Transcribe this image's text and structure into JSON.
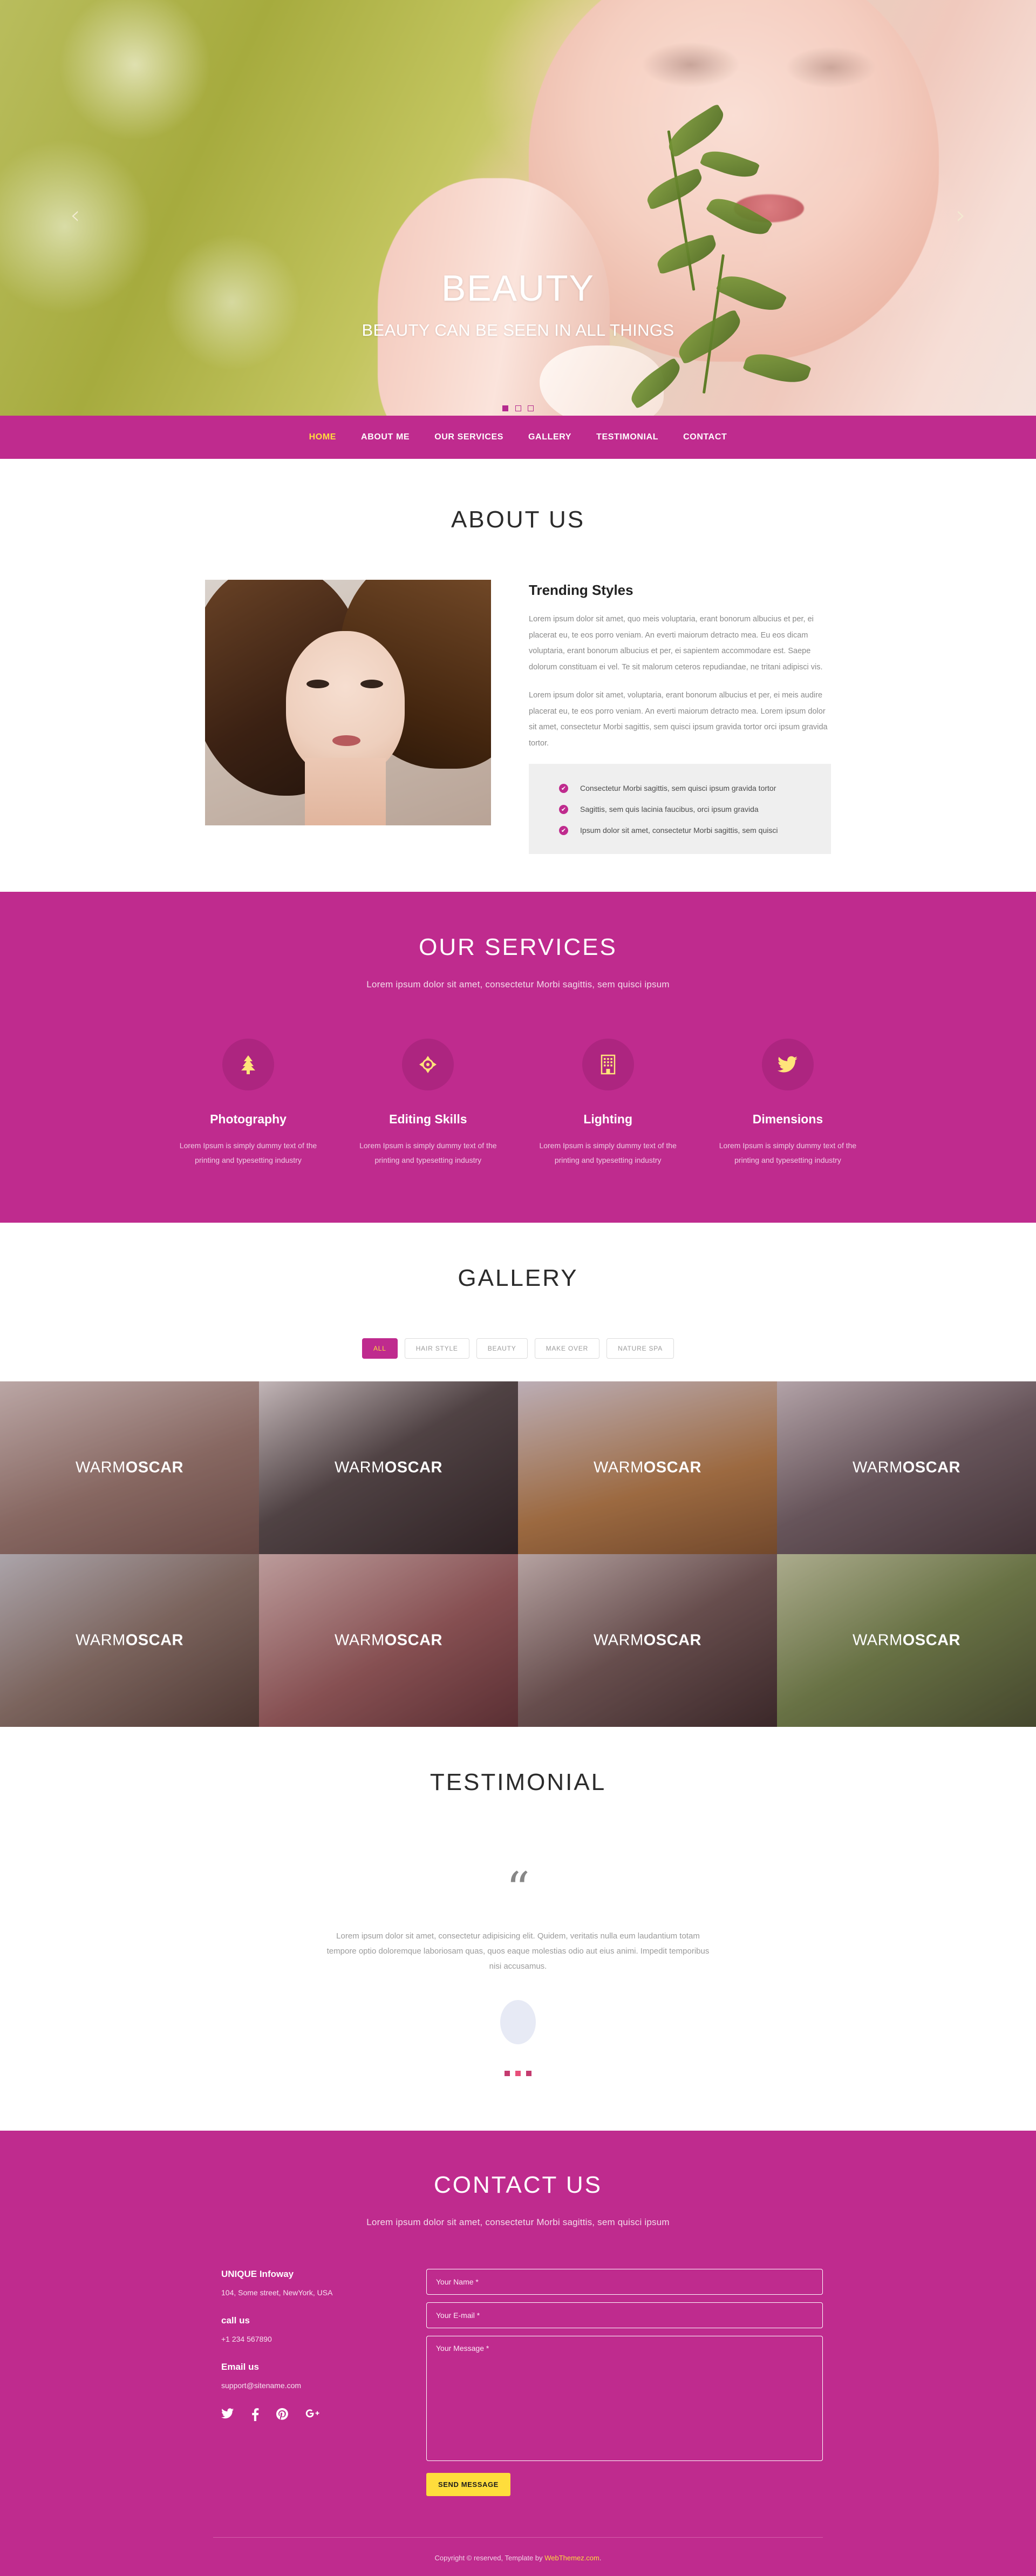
{
  "hero": {
    "title": "BEAUTY",
    "subtitle": "BEAUTY CAN BE SEEN IN ALL THINGS",
    "prev_arrow": "‹",
    "next_arrow": "›",
    "slide_count": 3,
    "active_slide": 1
  },
  "nav": {
    "items": [
      {
        "label": "HOME",
        "active": true
      },
      {
        "label": "ABOUT ME",
        "active": false
      },
      {
        "label": "OUR SERVICES",
        "active": false
      },
      {
        "label": "GALLERY",
        "active": false
      },
      {
        "label": "TESTIMONIAL",
        "active": false
      },
      {
        "label": "CONTACT",
        "active": false
      }
    ]
  },
  "about": {
    "title": "ABOUT US",
    "heading": "Trending Styles",
    "paragraph1": "Lorem ipsum dolor sit amet, quo meis voluptaria, erant bonorum albucius et per, ei placerat eu, te eos porro veniam. An everti maiorum detracto mea. Eu eos dicam voluptaria, erant bonorum albucius et per, ei sapientem accommodare est. Saepe dolorum constituam ei vel. Te sit malorum ceteros repudiandae, ne tritani adipisci vis.",
    "paragraph2": "Lorem ipsum dolor sit amet, voluptaria, erant bonorum albucius et per, ei meis audire placerat eu, te eos porro veniam. An everti maiorum detracto mea. Lorem ipsum dolor sit amet, consectetur Morbi sagittis, sem quisci ipsum gravida tortor orci ipsum gravida tortor.",
    "bullets": [
      "Consectetur Morbi sagittis, sem quisci ipsum gravida tortor",
      "Sagittis, sem quis lacinia faucibus, orci ipsum gravida",
      "Ipsum dolor sit amet, consectetur Morbi sagittis, sem quisci"
    ],
    "tick_glyph": "✔"
  },
  "services": {
    "title": "OUR SERVICES",
    "subtitle": "Lorem ipsum dolor sit amet, consectetur Morbi sagittis, sem quisci ipsum",
    "items": [
      {
        "icon": "tree-icon",
        "name": "Photography",
        "desc": "Lorem Ipsum is simply dummy text of the printing and typesetting industry"
      },
      {
        "icon": "crosshair-icon",
        "name": "Editing Skills",
        "desc": "Lorem Ipsum is simply dummy text of the printing and typesetting industry"
      },
      {
        "icon": "building-icon",
        "name": "Lighting",
        "desc": "Lorem Ipsum is simply dummy text of the printing and typesetting industry"
      },
      {
        "icon": "twitter-bird-icon",
        "name": "Dimensions",
        "desc": "Lorem Ipsum is simply dummy text of the printing and typesetting industry"
      }
    ]
  },
  "gallery": {
    "title": "GALLERY",
    "filters": [
      {
        "label": "ALL",
        "active": true
      },
      {
        "label": "HAIR STYLE",
        "active": false
      },
      {
        "label": "BEAUTY",
        "active": false
      },
      {
        "label": "MAKE OVER",
        "active": false
      },
      {
        "label": "NATURE SPA",
        "active": false
      }
    ],
    "items": [
      {
        "caption_light": "WARM",
        "caption_bold": "OSCAR"
      },
      {
        "caption_light": "WARM",
        "caption_bold": "OSCAR"
      },
      {
        "caption_light": "WARM",
        "caption_bold": "OSCAR"
      },
      {
        "caption_light": "WARM",
        "caption_bold": "OSCAR"
      },
      {
        "caption_light": "WARM",
        "caption_bold": "OSCAR"
      },
      {
        "caption_light": "WARM",
        "caption_bold": "OSCAR"
      },
      {
        "caption_light": "WARM",
        "caption_bold": "OSCAR"
      },
      {
        "caption_light": "WARM",
        "caption_bold": "OSCAR"
      }
    ]
  },
  "testimonial": {
    "title": "TESTIMONIAL",
    "quote_glyph": "“",
    "text": "Lorem ipsum dolor sit amet, consectetur adipisicing elit. Quidem, veritatis nulla eum laudantium totam tempore optio doloremque laboriosam quas, quos eaque molestias odio aut eius animi. Impedit temporibus nisi accusamus.",
    "dot_count": 3,
    "active_dot": 2
  },
  "contact": {
    "title": "CONTACT US",
    "subtitle": "Lorem ipsum dolor sit amet, consectetur Morbi sagittis, sem quisci ipsum",
    "company": "UNIQUE Infoway",
    "address": "104, Some street, NewYork, USA",
    "call_label": "call us",
    "phone": "+1 234 567890",
    "email_label": "Email us",
    "email": "support@sitename.com",
    "socials": [
      {
        "icon": "twitter-icon"
      },
      {
        "icon": "facebook-icon"
      },
      {
        "icon": "pinterest-icon"
      },
      {
        "icon": "google-plus-icon"
      }
    ],
    "form": {
      "name_placeholder": "Your Name *",
      "name_value": "",
      "email_placeholder": "Your E-mail *",
      "email_value": "",
      "message_placeholder": "Your Message *",
      "message_value": "",
      "submit_label": "SEND MESSAGE"
    }
  },
  "footer": {
    "text_before": "Copyright © reserved, Template by ",
    "link": "WebThemez.com",
    "text_after": "."
  },
  "colors": {
    "brand_magenta": "#bf2b8e",
    "accent_yellow": "#ffdd3c",
    "icon_yellow": "#ffe47a",
    "services_circle": "#ad2580",
    "list_bg": "#efefef"
  }
}
